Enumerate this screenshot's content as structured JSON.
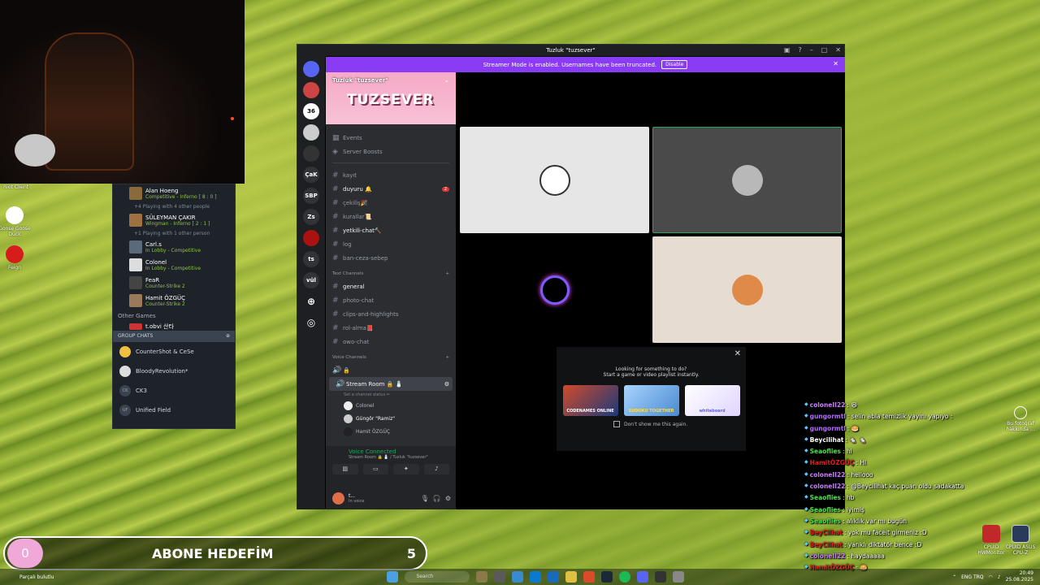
{
  "webcam": {
    "label": "Riot Client"
  },
  "desktop_icons": [
    {
      "label": "Goose Goose Duck"
    },
    {
      "label": "Feign"
    },
    {
      "label": "Bu fotoğraf hakkında ..."
    },
    {
      "label": "CPUID HWMonitor"
    },
    {
      "label": "CPUID ASUS CPU-Z"
    }
  ],
  "friends": {
    "rows": [
      {
        "name": "Alan Hoeng",
        "status": "Competitive - Inferno [ 8 : 0 ]"
      },
      {
        "name": "SÜLEYMAN ÇAKIR",
        "status": "Wingman - Inferno [ 2 : 1 ]"
      },
      {
        "name": "Carl.s",
        "status": "In Lobby - Competitive"
      },
      {
        "name": "Colonel",
        "status": "In Lobby - Competitive"
      },
      {
        "name": "FeaR",
        "status": "Counter-Strike 2"
      },
      {
        "name": "Hamit ÖZGÜÇ",
        "status": "Counter-Strike 2"
      }
    ],
    "sub1": "+4  Playing with 4 other people",
    "sub2": "+1  Playing with 1 other person",
    "other_games": "Other Games",
    "other_game_item": "t.obvi 산타",
    "group_chats_header": "GROUP CHATS",
    "group_chats": [
      {
        "icon": "",
        "name": "CounterShot & CeSe"
      },
      {
        "icon": "",
        "name": "BloodyRevolution*"
      },
      {
        "icon": "CK",
        "name": "CK3"
      },
      {
        "icon": "UF",
        "name": "Unified Field"
      }
    ]
  },
  "discord": {
    "title": "Tuzluk \"tuzsever\"",
    "banner_text": "Streamer Mode is enabled. Usernames have been truncated.",
    "banner_button": "Disable",
    "servers": [
      "",
      "",
      "36",
      "",
      "",
      "ÇaK",
      "SBP",
      "Zs",
      "",
      "ts",
      "vül"
    ],
    "guild_name": "Tuzluk \"tuzsever\"",
    "guild_logo": "TUZSEVER",
    "top_items": [
      "Events",
      "Server Boosts"
    ],
    "channels": [
      {
        "name": "kayıt",
        "unread": false,
        "badge": ""
      },
      {
        "name": "duyuru 🔔",
        "unread": true,
        "badge": "2"
      },
      {
        "name": "çekiliş🎉",
        "unread": false,
        "badge": ""
      },
      {
        "name": "kurallar📜",
        "unread": false,
        "badge": ""
      },
      {
        "name": "yetkili-chat🔨",
        "unread": true,
        "badge": ""
      },
      {
        "name": "log",
        "unread": false,
        "badge": ""
      },
      {
        "name": "ban-ceza-sebep",
        "unread": false,
        "badge": ""
      }
    ],
    "text_category": "Text Channels",
    "text_channels": [
      {
        "name": "general",
        "unread": true
      },
      {
        "name": "photo-chat",
        "unread": false
      },
      {
        "name": "clips-and-highlights",
        "unread": false
      },
      {
        "name": "rol-alma📕",
        "unread": false
      },
      {
        "name": "owo-chat",
        "unread": false
      }
    ],
    "voice_category": "Voice Channels",
    "voice_lock": "🔒",
    "voice_room": "Stream Room 🔒 🧂",
    "voice_room_status": "Set a channel status ✏",
    "voice_users": [
      "Colonel",
      "Güngör \"Ramiz\"",
      "Hamit ÖZGÜÇ"
    ],
    "voice_connected": "Voice Connected",
    "voice_sub": "Stream Room 🔒 🧂 / Tuzluk \"tuzsever\"",
    "user_name": "t...",
    "user_status": "In voice",
    "promo_title": "Looking for something to do?",
    "promo_sub": "Start a game or video playlist instantly.",
    "promo_games": [
      "CODENAMES ONLINE",
      "SUDOKU TOGETHER",
      "whiteboard"
    ],
    "promo_dont": "Don't show me this again."
  },
  "chat": [
    {
      "user": "coloneII22",
      "text": " : 😆",
      "color": "#c77dff"
    },
    {
      "user": "gungormtl",
      "text": " : selin abla temizlik yayını yapıyo :",
      "color": "#b46bff"
    },
    {
      "user": "gungormtl",
      "text": " : 🥯",
      "color": "#b46bff"
    },
    {
      "user": "Beycilihat",
      "text": " : 🐁 🐁",
      "color": "#ffffff"
    },
    {
      "user": "Seaoflies",
      "text": " : hi",
      "color": "#4ce04c"
    },
    {
      "user": "HamitÖZGÜÇ",
      "text": " : HI",
      "color": "#e02020"
    },
    {
      "user": "coloneII22",
      "text": " : hellooo",
      "color": "#c77dff"
    },
    {
      "user": "coloneII22",
      "text": " : @Beycilihat kaç puan oldu sadakatta",
      "color": "#c77dff"
    },
    {
      "user": "Seaoflies",
      "text": " : hb",
      "color": "#4ce04c"
    },
    {
      "user": "Seaoflies",
      "text": " : iyimiş",
      "color": "#4ce04c"
    },
    {
      "user": "Seaoflies",
      "text": " : alıklık var mı bugün",
      "color": "#4ce04c"
    },
    {
      "user": "BeyCilhat",
      "text": " : yok mu faceit girmeniz :D",
      "color": "#e02020"
    },
    {
      "user": "BeyCilhat",
      "text": " : yarıklı diktatör bence :D",
      "color": "#e02020"
    },
    {
      "user": "coloneII22",
      "text": " : haydaaaaa",
      "color": "#c77dff"
    },
    {
      "user": "HamitÖZGÜÇ",
      "text": " : 🥯",
      "color": "#e02020"
    }
  ],
  "goal": {
    "current": "0",
    "label": "ABONE HEDEFİM",
    "target": "5"
  },
  "taskbar": {
    "bottom_label": "Parçalı bulutlu",
    "search": "Search",
    "lang": "ENG TRQ",
    "time": "20:49",
    "date": "25.08.2025"
  }
}
